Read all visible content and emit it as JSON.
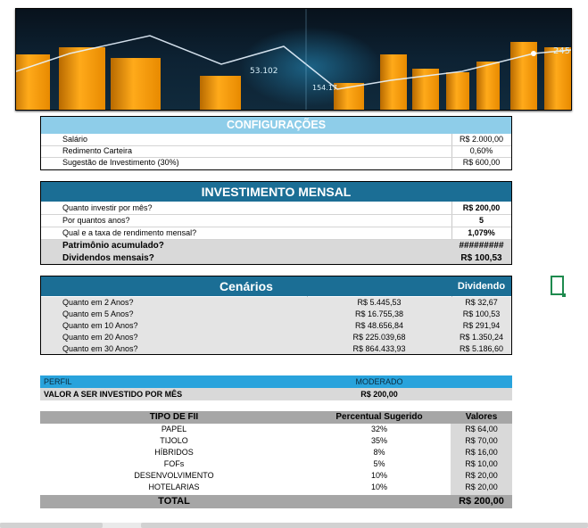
{
  "banner": {
    "numbers": [
      "53.102",
      "154.17",
      "245.57"
    ]
  },
  "config": {
    "title": "CONFIGURAÇÕES",
    "rows": [
      {
        "label": "Salário",
        "value": "R$ 2.000,00"
      },
      {
        "label": "Redimento Carteira",
        "value": "0,60%"
      },
      {
        "label": "Sugestão de Investimento (30%)",
        "value": "R$ 600,00"
      }
    ]
  },
  "investimento": {
    "title": "INVESTIMENTO MENSAL",
    "inputs": [
      {
        "label": "Quanto investir por mês?",
        "value": "R$ 200,00"
      },
      {
        "label": "Por quantos anos?",
        "value": "5"
      },
      {
        "label": "Qual e a taxa de rendimento mensal?",
        "value": "1,079%"
      }
    ],
    "results": [
      {
        "label": "Patrimônio acumulado?",
        "value": "#########"
      },
      {
        "label": "Dividendos mensais?",
        "value": "R$ 100,53"
      }
    ]
  },
  "cenarios": {
    "title": "Cenários",
    "dividend_header": "Dividendo",
    "rows": [
      {
        "label": "Quanto em 2 Anos?",
        "value": "R$ 5.445,53",
        "dividend": "R$ 32,67"
      },
      {
        "label": "Quanto em 5 Anos?",
        "value": "R$ 16.755,38",
        "dividend": "R$ 100,53"
      },
      {
        "label": "Quanto em 10 Anos?",
        "value": "R$ 48.656,84",
        "dividend": "R$ 291,94"
      },
      {
        "label": "Quanto em 20 Anos?",
        "value": "R$ 225.039,68",
        "dividend": "R$ 1.350,24"
      },
      {
        "label": "Quanto em 30 Anos?",
        "value": "R$ 864.433,93",
        "dividend": "R$ 5.186,60"
      }
    ]
  },
  "perfil": {
    "label": "PERFIL",
    "value": "MODERADO",
    "invest_label": "VALOR A SER INVESTIDO POR MÊS",
    "invest_value": "R$ 200,00"
  },
  "fii": {
    "headers": {
      "tipo": "TIPO DE FII",
      "percentual": "Percentual Sugerido",
      "valores": "Valores"
    },
    "rows": [
      {
        "tipo": "PAPEL",
        "percent": "32%",
        "valor": "R$ 64,00"
      },
      {
        "tipo": "TIJOLO",
        "percent": "35%",
        "valor": "R$ 70,00"
      },
      {
        "tipo": "HÍBRIDOS",
        "percent": "8%",
        "valor": "R$ 16,00"
      },
      {
        "tipo": "FOFs",
        "percent": "5%",
        "valor": "R$ 10,00"
      },
      {
        "tipo": "DESENVOLVIMENTO",
        "percent": "10%",
        "valor": "R$ 20,00"
      },
      {
        "tipo": "HOTELARIAS",
        "percent": "10%",
        "valor": "R$ 20,00"
      }
    ],
    "total_label": "TOTAL",
    "total_value": "R$ 200,00"
  },
  "colors": {
    "light_blue": "#8ecde9",
    "dark_blue": "#1b6e95",
    "perfil_blue": "#29a3dc",
    "gray": "#d9d9d9",
    "total_gray": "#a6a6a6",
    "cell_green": "#1e8a4e"
  }
}
